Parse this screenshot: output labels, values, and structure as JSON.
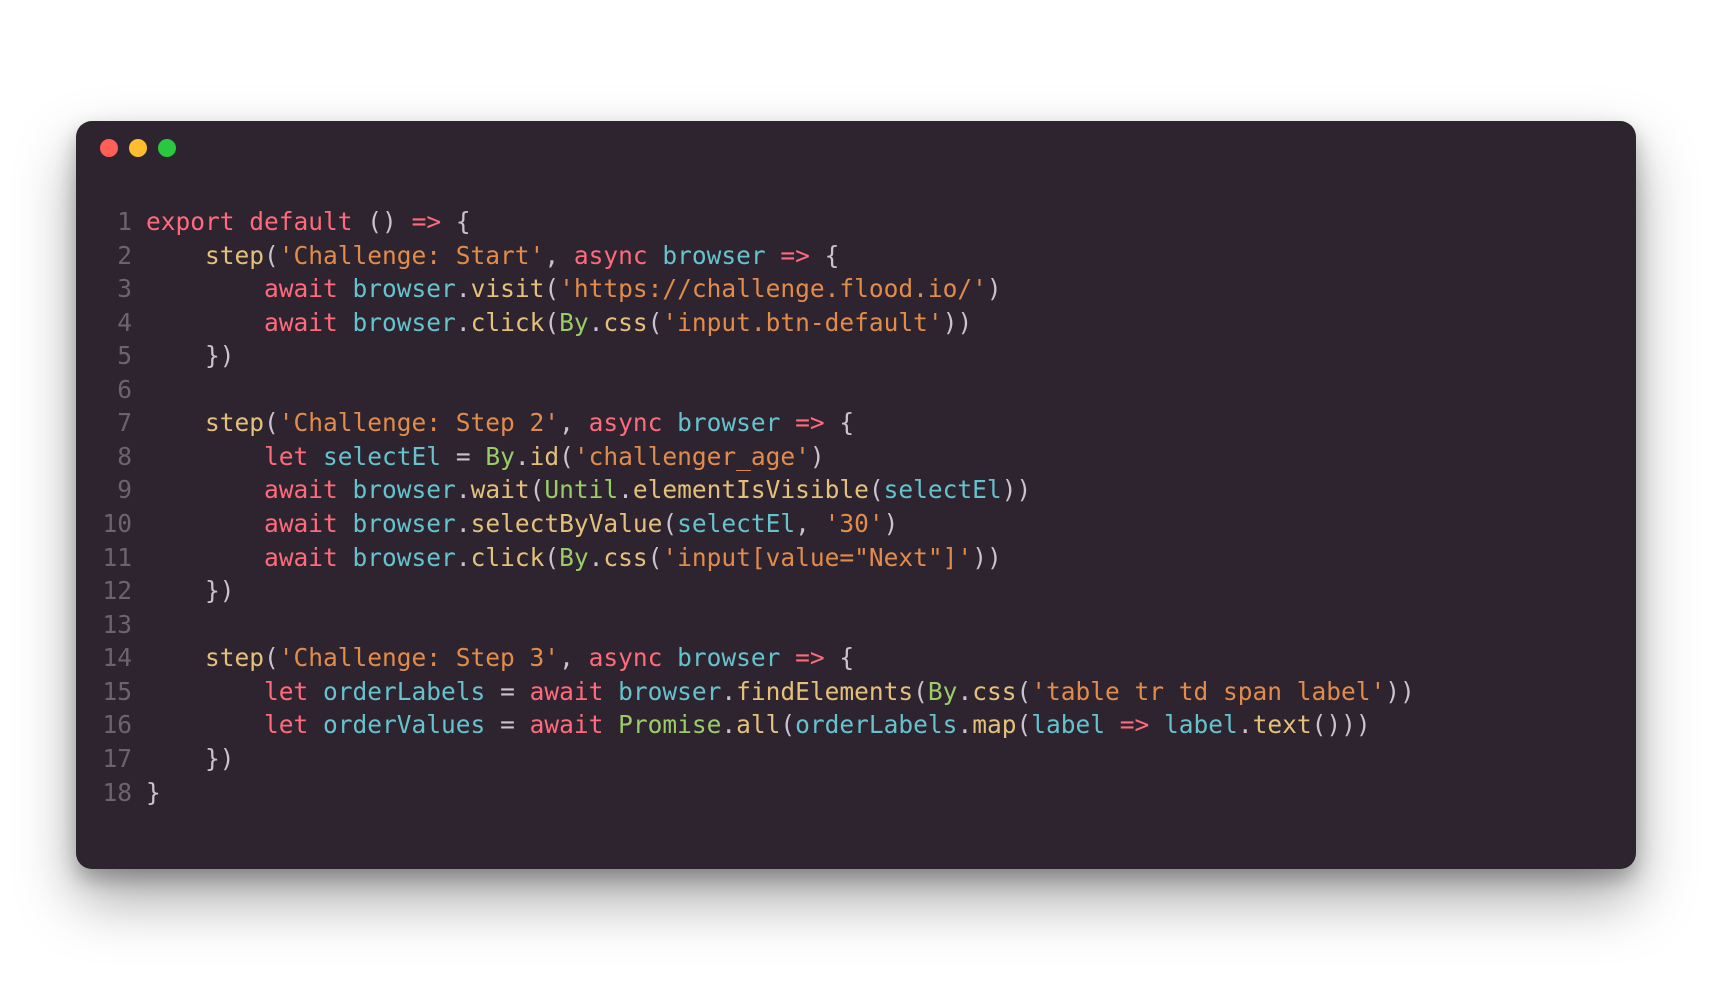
{
  "window": {
    "traffic_lights": [
      "red",
      "yellow",
      "green"
    ]
  },
  "code": {
    "lines": [
      {
        "num": "1",
        "tokens": [
          {
            "t": "export",
            "c": "kw-red"
          },
          {
            "t": " ",
            "c": "punct"
          },
          {
            "t": "default",
            "c": "kw-red"
          },
          {
            "t": " () ",
            "c": "punct"
          },
          {
            "t": "=>",
            "c": "arrow"
          },
          {
            "t": " {",
            "c": "punct"
          }
        ]
      },
      {
        "num": "2",
        "tokens": [
          {
            "t": "    ",
            "c": "punct"
          },
          {
            "t": "step",
            "c": "fn-yellow"
          },
          {
            "t": "(",
            "c": "punct"
          },
          {
            "t": "'Challenge: Start'",
            "c": "str-orange"
          },
          {
            "t": ", ",
            "c": "punct"
          },
          {
            "t": "async",
            "c": "kw-red"
          },
          {
            "t": " ",
            "c": "punct"
          },
          {
            "t": "browser",
            "c": "kw-teal"
          },
          {
            "t": " ",
            "c": "punct"
          },
          {
            "t": "=>",
            "c": "arrow"
          },
          {
            "t": " {",
            "c": "punct"
          }
        ]
      },
      {
        "num": "3",
        "tokens": [
          {
            "t": "        ",
            "c": "punct"
          },
          {
            "t": "await",
            "c": "kw-red"
          },
          {
            "t": " ",
            "c": "punct"
          },
          {
            "t": "browser",
            "c": "kw-teal"
          },
          {
            "t": ".",
            "c": "punct"
          },
          {
            "t": "visit",
            "c": "fn-yellow"
          },
          {
            "t": "(",
            "c": "punct"
          },
          {
            "t": "'https://challenge.flood.io/'",
            "c": "str-orange"
          },
          {
            "t": ")",
            "c": "punct"
          }
        ]
      },
      {
        "num": "4",
        "tokens": [
          {
            "t": "        ",
            "c": "punct"
          },
          {
            "t": "await",
            "c": "kw-red"
          },
          {
            "t": " ",
            "c": "punct"
          },
          {
            "t": "browser",
            "c": "kw-teal"
          },
          {
            "t": ".",
            "c": "punct"
          },
          {
            "t": "click",
            "c": "fn-yellow"
          },
          {
            "t": "(",
            "c": "punct"
          },
          {
            "t": "By",
            "c": "type-green"
          },
          {
            "t": ".",
            "c": "punct"
          },
          {
            "t": "css",
            "c": "fn-yellow"
          },
          {
            "t": "(",
            "c": "punct"
          },
          {
            "t": "'input.btn-default'",
            "c": "str-orange"
          },
          {
            "t": "))",
            "c": "punct"
          }
        ]
      },
      {
        "num": "5",
        "tokens": [
          {
            "t": "    })",
            "c": "punct"
          }
        ]
      },
      {
        "num": "6",
        "tokens": [
          {
            "t": "",
            "c": "punct"
          }
        ]
      },
      {
        "num": "7",
        "tokens": [
          {
            "t": "    ",
            "c": "punct"
          },
          {
            "t": "step",
            "c": "fn-yellow"
          },
          {
            "t": "(",
            "c": "punct"
          },
          {
            "t": "'Challenge: Step 2'",
            "c": "str-orange"
          },
          {
            "t": ", ",
            "c": "punct"
          },
          {
            "t": "async",
            "c": "kw-red"
          },
          {
            "t": " ",
            "c": "punct"
          },
          {
            "t": "browser",
            "c": "kw-teal"
          },
          {
            "t": " ",
            "c": "punct"
          },
          {
            "t": "=>",
            "c": "arrow"
          },
          {
            "t": " {",
            "c": "punct"
          }
        ]
      },
      {
        "num": "8",
        "tokens": [
          {
            "t": "        ",
            "c": "punct"
          },
          {
            "t": "let",
            "c": "kw-red"
          },
          {
            "t": " ",
            "c": "punct"
          },
          {
            "t": "selectEl",
            "c": "kw-teal"
          },
          {
            "t": " = ",
            "c": "punct"
          },
          {
            "t": "By",
            "c": "type-green"
          },
          {
            "t": ".",
            "c": "punct"
          },
          {
            "t": "id",
            "c": "fn-yellow"
          },
          {
            "t": "(",
            "c": "punct"
          },
          {
            "t": "'challenger_age'",
            "c": "str-orange"
          },
          {
            "t": ")",
            "c": "punct"
          }
        ]
      },
      {
        "num": "9",
        "tokens": [
          {
            "t": "        ",
            "c": "punct"
          },
          {
            "t": "await",
            "c": "kw-red"
          },
          {
            "t": " ",
            "c": "punct"
          },
          {
            "t": "browser",
            "c": "kw-teal"
          },
          {
            "t": ".",
            "c": "punct"
          },
          {
            "t": "wait",
            "c": "fn-yellow"
          },
          {
            "t": "(",
            "c": "punct"
          },
          {
            "t": "Until",
            "c": "type-green"
          },
          {
            "t": ".",
            "c": "punct"
          },
          {
            "t": "elementIsVisible",
            "c": "fn-yellow"
          },
          {
            "t": "(",
            "c": "punct"
          },
          {
            "t": "selectEl",
            "c": "kw-teal"
          },
          {
            "t": "))",
            "c": "punct"
          }
        ]
      },
      {
        "num": "10",
        "tokens": [
          {
            "t": "        ",
            "c": "punct"
          },
          {
            "t": "await",
            "c": "kw-red"
          },
          {
            "t": " ",
            "c": "punct"
          },
          {
            "t": "browser",
            "c": "kw-teal"
          },
          {
            "t": ".",
            "c": "punct"
          },
          {
            "t": "selectByValue",
            "c": "fn-yellow"
          },
          {
            "t": "(",
            "c": "punct"
          },
          {
            "t": "selectEl",
            "c": "kw-teal"
          },
          {
            "t": ", ",
            "c": "punct"
          },
          {
            "t": "'30'",
            "c": "str-orange"
          },
          {
            "t": ")",
            "c": "punct"
          }
        ]
      },
      {
        "num": "11",
        "tokens": [
          {
            "t": "        ",
            "c": "punct"
          },
          {
            "t": "await",
            "c": "kw-red"
          },
          {
            "t": " ",
            "c": "punct"
          },
          {
            "t": "browser",
            "c": "kw-teal"
          },
          {
            "t": ".",
            "c": "punct"
          },
          {
            "t": "click",
            "c": "fn-yellow"
          },
          {
            "t": "(",
            "c": "punct"
          },
          {
            "t": "By",
            "c": "type-green"
          },
          {
            "t": ".",
            "c": "punct"
          },
          {
            "t": "css",
            "c": "fn-yellow"
          },
          {
            "t": "(",
            "c": "punct"
          },
          {
            "t": "'input[value=\"Next\"]'",
            "c": "str-orange"
          },
          {
            "t": "))",
            "c": "punct"
          }
        ]
      },
      {
        "num": "12",
        "tokens": [
          {
            "t": "    })",
            "c": "punct"
          }
        ]
      },
      {
        "num": "13",
        "tokens": [
          {
            "t": "",
            "c": "punct"
          }
        ]
      },
      {
        "num": "14",
        "tokens": [
          {
            "t": "    ",
            "c": "punct"
          },
          {
            "t": "step",
            "c": "fn-yellow"
          },
          {
            "t": "(",
            "c": "punct"
          },
          {
            "t": "'Challenge: Step 3'",
            "c": "str-orange"
          },
          {
            "t": ", ",
            "c": "punct"
          },
          {
            "t": "async",
            "c": "kw-red"
          },
          {
            "t": " ",
            "c": "punct"
          },
          {
            "t": "browser",
            "c": "kw-teal"
          },
          {
            "t": " ",
            "c": "punct"
          },
          {
            "t": "=>",
            "c": "arrow"
          },
          {
            "t": " {",
            "c": "punct"
          }
        ]
      },
      {
        "num": "15",
        "tokens": [
          {
            "t": "        ",
            "c": "punct"
          },
          {
            "t": "let",
            "c": "kw-red"
          },
          {
            "t": " ",
            "c": "punct"
          },
          {
            "t": "orderLabels",
            "c": "kw-teal"
          },
          {
            "t": " = ",
            "c": "punct"
          },
          {
            "t": "await",
            "c": "kw-red"
          },
          {
            "t": " ",
            "c": "punct"
          },
          {
            "t": "browser",
            "c": "kw-teal"
          },
          {
            "t": ".",
            "c": "punct"
          },
          {
            "t": "findElements",
            "c": "fn-yellow"
          },
          {
            "t": "(",
            "c": "punct"
          },
          {
            "t": "By",
            "c": "type-green"
          },
          {
            "t": ".",
            "c": "punct"
          },
          {
            "t": "css",
            "c": "fn-yellow"
          },
          {
            "t": "(",
            "c": "punct"
          },
          {
            "t": "'table tr td span label'",
            "c": "str-orange"
          },
          {
            "t": "))",
            "c": "punct"
          }
        ]
      },
      {
        "num": "16",
        "tokens": [
          {
            "t": "        ",
            "c": "punct"
          },
          {
            "t": "let",
            "c": "kw-red"
          },
          {
            "t": " ",
            "c": "punct"
          },
          {
            "t": "orderValues",
            "c": "kw-teal"
          },
          {
            "t": " = ",
            "c": "punct"
          },
          {
            "t": "await",
            "c": "kw-red"
          },
          {
            "t": " ",
            "c": "punct"
          },
          {
            "t": "Promise",
            "c": "type-green"
          },
          {
            "t": ".",
            "c": "punct"
          },
          {
            "t": "all",
            "c": "fn-yellow"
          },
          {
            "t": "(",
            "c": "punct"
          },
          {
            "t": "orderLabels",
            "c": "kw-teal"
          },
          {
            "t": ".",
            "c": "punct"
          },
          {
            "t": "map",
            "c": "fn-yellow"
          },
          {
            "t": "(",
            "c": "punct"
          },
          {
            "t": "label",
            "c": "kw-teal"
          },
          {
            "t": " ",
            "c": "punct"
          },
          {
            "t": "=>",
            "c": "arrow"
          },
          {
            "t": " ",
            "c": "punct"
          },
          {
            "t": "label",
            "c": "kw-teal"
          },
          {
            "t": ".",
            "c": "punct"
          },
          {
            "t": "text",
            "c": "fn-yellow"
          },
          {
            "t": "()))",
            "c": "punct"
          }
        ]
      },
      {
        "num": "17",
        "tokens": [
          {
            "t": "    })",
            "c": "punct"
          }
        ]
      },
      {
        "num": "18",
        "tokens": [
          {
            "t": "}",
            "c": "punct"
          }
        ]
      }
    ]
  }
}
